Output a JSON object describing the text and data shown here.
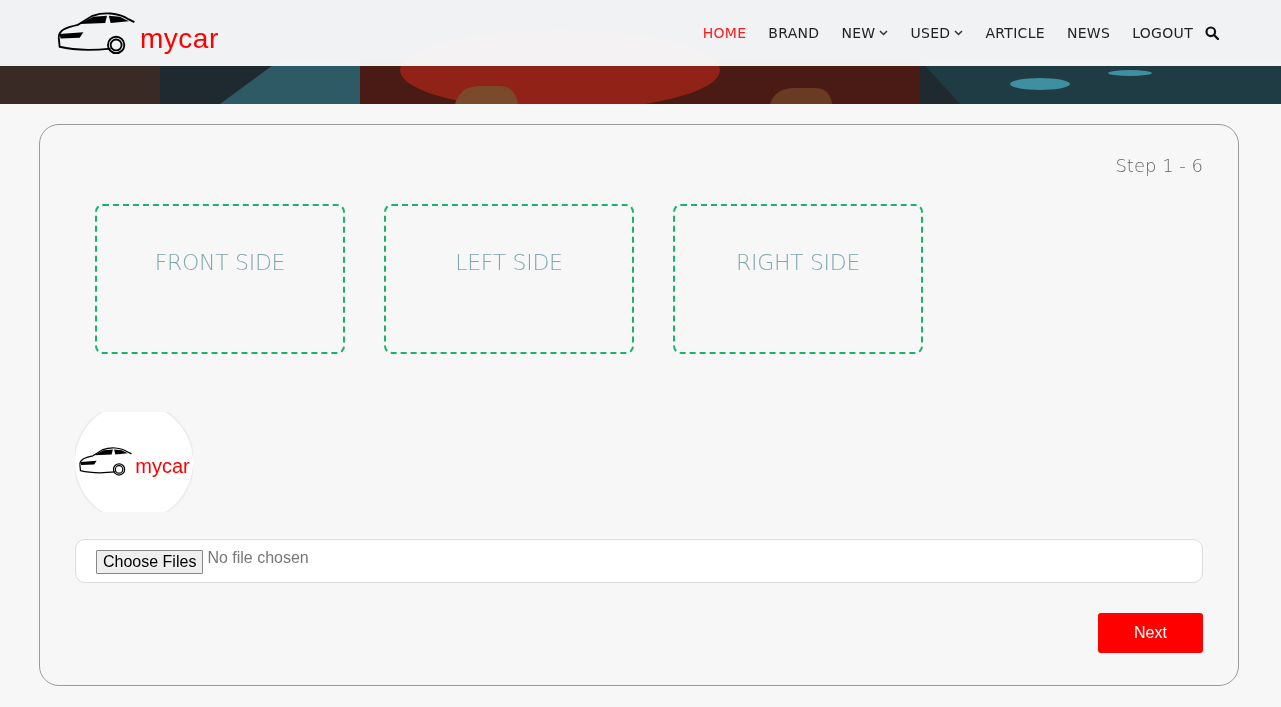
{
  "header": {
    "logo_text": "mycar",
    "nav": [
      {
        "label": "HOME",
        "kind": "link",
        "selected": true
      },
      {
        "label": "BRAND",
        "kind": "link",
        "selected": false
      },
      {
        "label": "NEW",
        "kind": "dropdown",
        "selected": false
      },
      {
        "label": "USED",
        "kind": "dropdown",
        "selected": false
      },
      {
        "label": "ARTICLE",
        "kind": "link",
        "selected": false
      },
      {
        "label": "NEWS",
        "kind": "link",
        "selected": false
      },
      {
        "label": "LOGOUT",
        "kind": "link",
        "selected": false
      }
    ]
  },
  "form": {
    "step": "Step 1 - 6",
    "slots": [
      {
        "label": "FRONT SIDE"
      },
      {
        "label": "LEFT SIDE"
      },
      {
        "label": "RIGHT SIDE"
      }
    ],
    "preview": {
      "logo_text": "mycar"
    },
    "file_input": {
      "button": "Choose Files",
      "status": "No file chosen"
    },
    "next_button": "Next"
  }
}
